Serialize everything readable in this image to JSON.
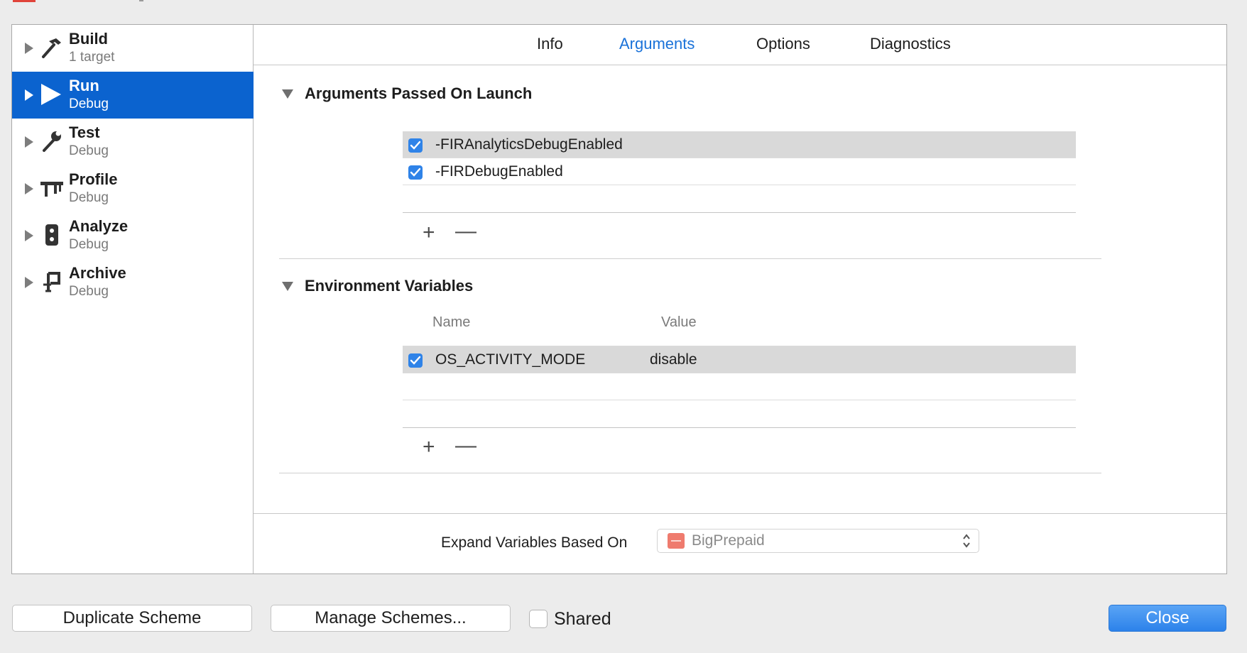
{
  "sidebar": {
    "items": [
      {
        "title": "Build",
        "subtitle": "1 target",
        "icon": "hammer-icon"
      },
      {
        "title": "Run",
        "subtitle": "Debug",
        "icon": "play-icon",
        "selected": true
      },
      {
        "title": "Test",
        "subtitle": "Debug",
        "icon": "wrench-icon"
      },
      {
        "title": "Profile",
        "subtitle": "Debug",
        "icon": "caliper-icon"
      },
      {
        "title": "Analyze",
        "subtitle": "Debug",
        "icon": "analyze-icon"
      },
      {
        "title": "Archive",
        "subtitle": "Debug",
        "icon": "archive-clamp-icon"
      }
    ]
  },
  "tabs": {
    "info": "Info",
    "arguments": "Arguments",
    "options": "Options",
    "diagnostics": "Diagnostics",
    "active": "Arguments"
  },
  "arguments_section": {
    "title": "Arguments Passed On Launch",
    "rows": [
      {
        "checked": true,
        "value": "-FIRAnalyticsDebugEnabled"
      },
      {
        "checked": true,
        "value": "-FIRDebugEnabled"
      }
    ]
  },
  "env_section": {
    "title": "Environment Variables",
    "col_name": "Name",
    "col_value": "Value",
    "rows": [
      {
        "checked": true,
        "name": "OS_ACTIVITY_MODE",
        "value": "disable"
      }
    ]
  },
  "controls": {
    "plus": "+",
    "minus": "—"
  },
  "footer": {
    "expand_label": "Expand Variables Based On",
    "expand_value": "BigPrepaid"
  },
  "buttons": {
    "duplicate": "Duplicate Scheme",
    "manage": "Manage Schemes...",
    "shared": "Shared",
    "close": "Close"
  },
  "colors": {
    "selection": "#0b63cf",
    "accent": "#1a72d9",
    "checkbox": "#2f83e8"
  }
}
